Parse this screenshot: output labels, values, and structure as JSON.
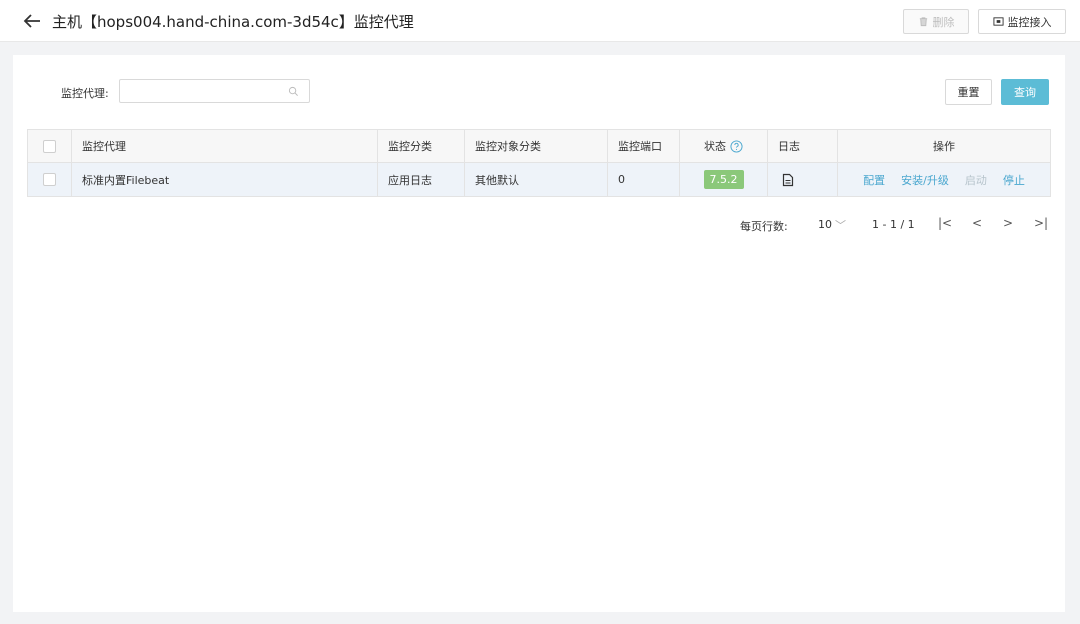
{
  "header": {
    "title": "主机【hops004.hand-china.com-3d54c】监控代理",
    "delete_label": "删除",
    "connect_label": "监控接入"
  },
  "filter": {
    "label": "监控代理:",
    "value": "",
    "reset_label": "重置",
    "query_label": "查询"
  },
  "table": {
    "columns": [
      "监控代理",
      "监控分类",
      "监控对象分类",
      "监控端口",
      "状态",
      "日志",
      "操作"
    ],
    "rows": [
      {
        "name": "标准内置Filebeat",
        "category": "应用日志",
        "object_category": "其他默认",
        "port": "0",
        "status": "7.5.2",
        "actions": [
          "配置",
          "安装/升级",
          "启动",
          "停止"
        ]
      }
    ]
  },
  "pagination": {
    "label": "每页行数:",
    "page_size": "10",
    "range": "1 - 1 / 1",
    "first": "|<",
    "prev": "<",
    "next": ">",
    "last": ">|"
  },
  "colors": {
    "accent": "#5cbcd6",
    "link": "#4aa7cf",
    "badge": "#8bc87a",
    "row_highlight": "#eef3f9"
  }
}
